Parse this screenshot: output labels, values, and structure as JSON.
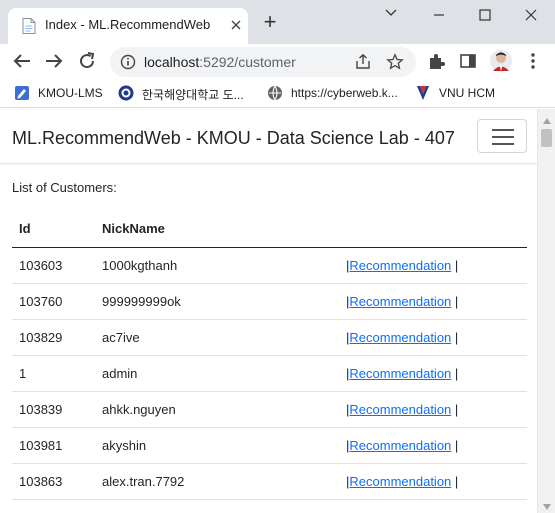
{
  "browser": {
    "tab": {
      "title": "Index - ML.RecommendWeb",
      "close_icon": "close-icon",
      "favicon": "document-icon"
    },
    "new_tab_label": "+",
    "window_controls": [
      "minimize-icon",
      "maximize-icon",
      "close-icon"
    ],
    "tab_search_icon": "chevron-down-icon",
    "address": {
      "host": "localhost",
      "rest": ":5292/customer"
    },
    "toolbar_icons": [
      "back-icon",
      "forward-icon",
      "reload-icon",
      "info-icon",
      "share-icon",
      "star-icon",
      "extensions-icon",
      "sidepanel-icon",
      "profile-avatar",
      "menu-icon"
    ],
    "bookmarks": [
      {
        "label": "KMOU-LMS",
        "icon": "kmou-lms-icon"
      },
      {
        "label": "한국해양대학교 도...",
        "icon": "kmou-seal-icon"
      },
      {
        "label": "https://cyberweb.k...",
        "icon": "globe-icon"
      },
      {
        "label": "VNU HCM",
        "icon": "vnu-icon"
      }
    ]
  },
  "page": {
    "brand": "ML.RecommendWeb - KMOU - Data Science Lab - 407",
    "toggler_icon": "hamburger-icon",
    "caption": "List of Customers:",
    "table": {
      "headers": {
        "id": "Id",
        "nickname": "NickName"
      },
      "link_label": "Recommendation",
      "sep_left": "|",
      "sep_right": "|",
      "rows": [
        {
          "id": "103603",
          "nickname": "1000kgthanh"
        },
        {
          "id": "103760",
          "nickname": "999999999ok"
        },
        {
          "id": "103829",
          "nickname": "ac7ive"
        },
        {
          "id": "1",
          "nickname": "admin"
        },
        {
          "id": "103839",
          "nickname": "ahkk.nguyen"
        },
        {
          "id": "103981",
          "nickname": "akyshin"
        },
        {
          "id": "103863",
          "nickname": "alex.tran.7792"
        }
      ]
    }
  },
  "colors": {
    "link": "#0d6efd",
    "tabstrip": "#dee1e6",
    "omnibox": "#f1f3f4"
  }
}
